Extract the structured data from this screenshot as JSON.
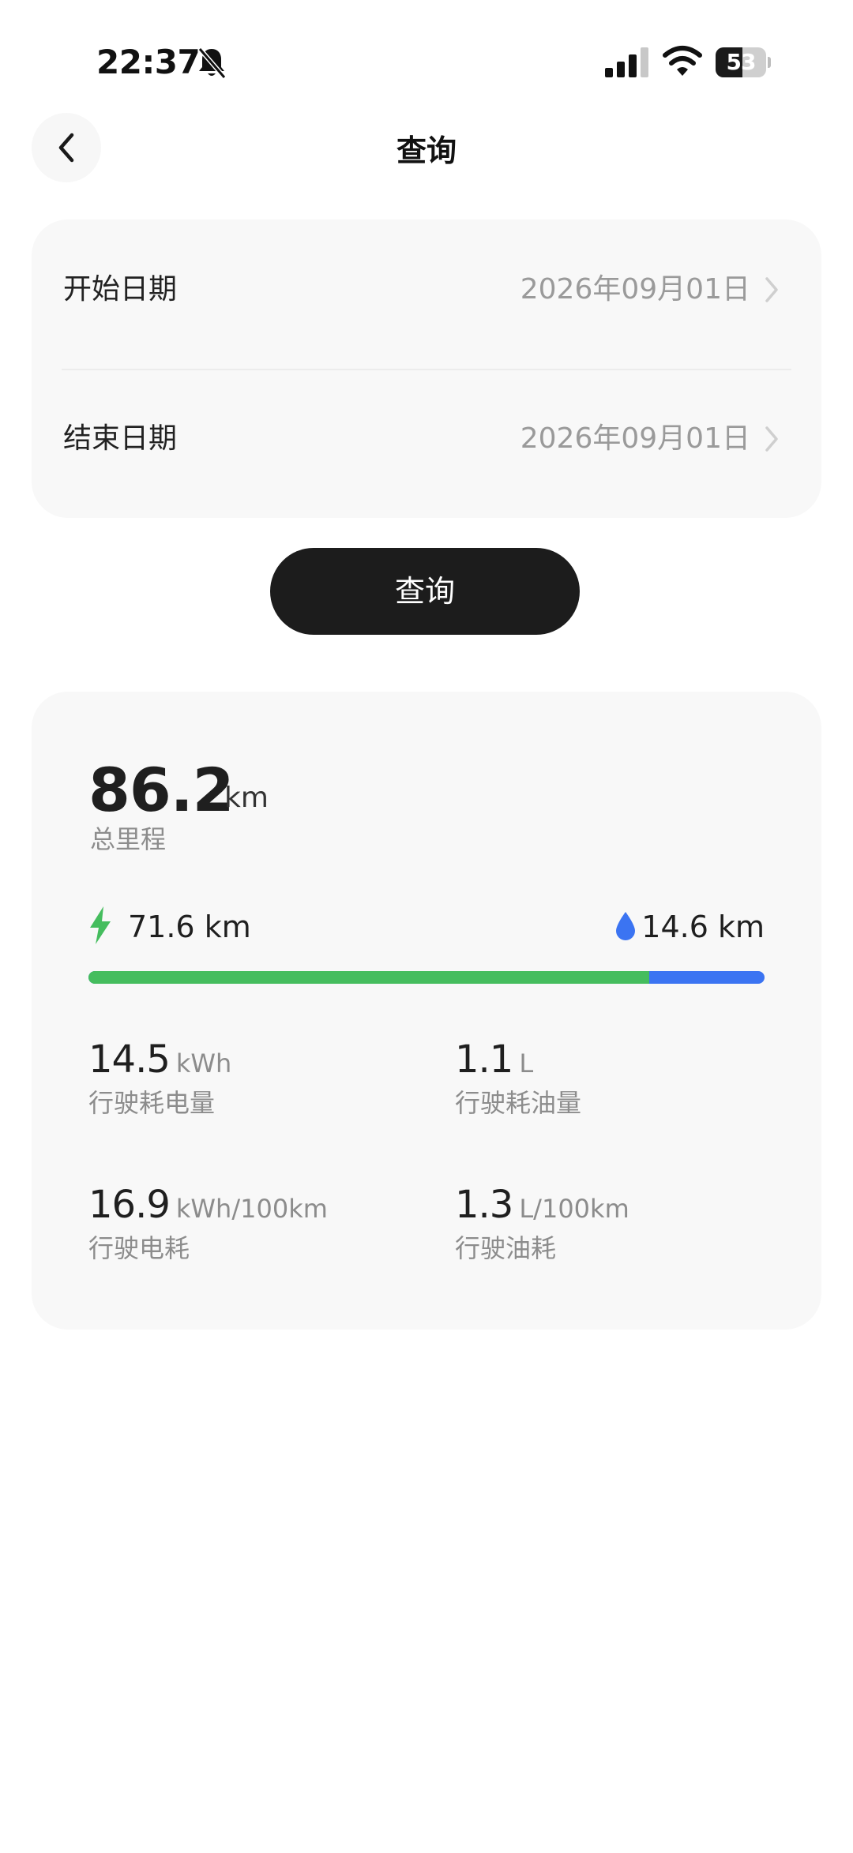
{
  "status_bar": {
    "time": "22:37",
    "battery": "53",
    "battery_level": 0.53,
    "icons": [
      "bell-slash-icon",
      "cellular-signal-icon",
      "wifi-icon",
      "battery-icon"
    ]
  },
  "nav": {
    "back_icon": "chevron-left-icon",
    "title": "查询"
  },
  "date_card": {
    "start_label": "开始日期",
    "start_value": "2026年09月01日",
    "end_label": "结束日期",
    "end_value": "2026年09月01日",
    "chevron_icon": "chevron-right-icon"
  },
  "query_button": "查询",
  "stats": {
    "total_value": "86.2",
    "total_unit": "km",
    "total_label": "总里程",
    "electric": {
      "icon": "lightning-bolt-icon",
      "value": "71.6 km",
      "color": "#45bd5e"
    },
    "fuel": {
      "icon": "fuel-drop-icon",
      "value": "14.6 km",
      "color": "#3b74f2"
    },
    "electric_share": 0.83,
    "metrics": [
      {
        "value": "14.5",
        "unit": "kWh",
        "label": "行驶耗电量"
      },
      {
        "value": "1.1",
        "unit": "L",
        "label": "行驶耗油量"
      },
      {
        "value": "16.9",
        "unit": "kWh/100km",
        "label": "行驶电耗"
      },
      {
        "value": "1.3",
        "unit": "L/100km",
        "label": "行驶油耗"
      }
    ]
  },
  "colors": {
    "electric": "#45bd5e",
    "fuel": "#3b74f2",
    "button": "#1c1c1c",
    "card": "#f8f8f8"
  }
}
